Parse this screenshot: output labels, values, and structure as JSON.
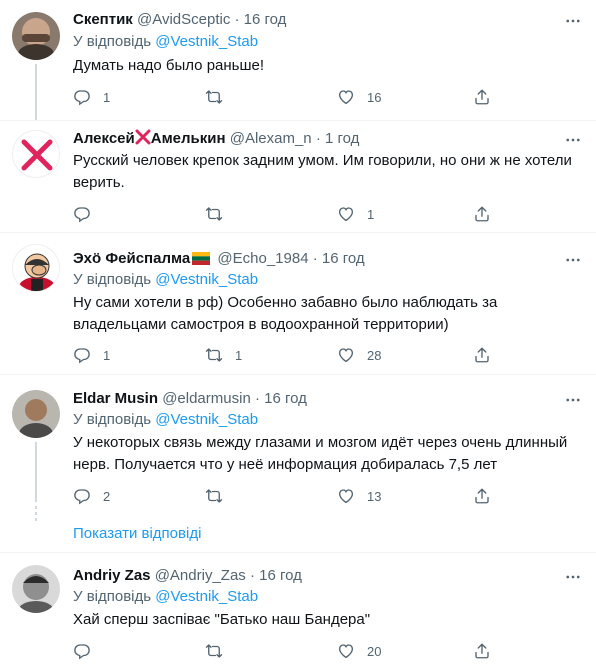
{
  "tweets": [
    {
      "name": "Скептик",
      "handle": "@AvidSceptic",
      "sep": "·",
      "time": "16 год",
      "reply_prefix": "У відповідь",
      "reply_mention": "@Vestnik_Stab",
      "text": "Думать надо было раньше!",
      "replies": "1",
      "retweets": "",
      "likes": "16"
    },
    {
      "name_part1": "Алексей",
      "name_part2": "Амелькин",
      "handle": "@Alexam_n",
      "sep": "·",
      "time": "1 год",
      "text": "Русский человек крепок задним умом. Им говорили, но они ж не хотели верить.",
      "replies": "",
      "retweets": "",
      "likes": "1"
    },
    {
      "name": "Эхӧ Фейспалма",
      "handle": "@Echo_1984",
      "sep": "·",
      "time": "16 год",
      "reply_prefix": "У відповідь",
      "reply_mention": "@Vestnik_Stab",
      "text": "Ну сами хотели в рф) Особенно забавно было наблюдать за владельцами самостроя в водоохранной территории)",
      "replies": "1",
      "retweets": "1",
      "likes": "28"
    },
    {
      "name": "Eldar Musin",
      "handle": "@eldarmusin",
      "sep": "·",
      "time": "16 год",
      "reply_prefix": "У відповідь",
      "reply_mention": "@Vestnik_Stab",
      "text": "У некоторых связь между глазами и мозгом идёт через очень длинный нерв. Получается что у неё информация добиралась 7,5 лет",
      "replies": "2",
      "retweets": "",
      "likes": "13"
    },
    {
      "name": "Andriy Zas",
      "handle": "@Andriy_Zas",
      "sep": "·",
      "time": "16 год",
      "reply_prefix": "У відповідь",
      "reply_mention": "@Vestnik_Stab",
      "text": "Хай сперш заспіває \"Батько наш Бандера\"",
      "replies": "",
      "retweets": "",
      "likes": "20"
    }
  ],
  "show_replies_label": "Показати відповіді",
  "colors": {
    "accent": "#1d9bf0",
    "secondary_text": "#536471",
    "divider": "#eff3f4",
    "red_x": "#e0245e"
  },
  "icons": [
    "reply-icon",
    "retweet-icon",
    "like-icon",
    "share-icon",
    "more-icon",
    "cross-mark-icon",
    "lithuania-flag-icon"
  ]
}
